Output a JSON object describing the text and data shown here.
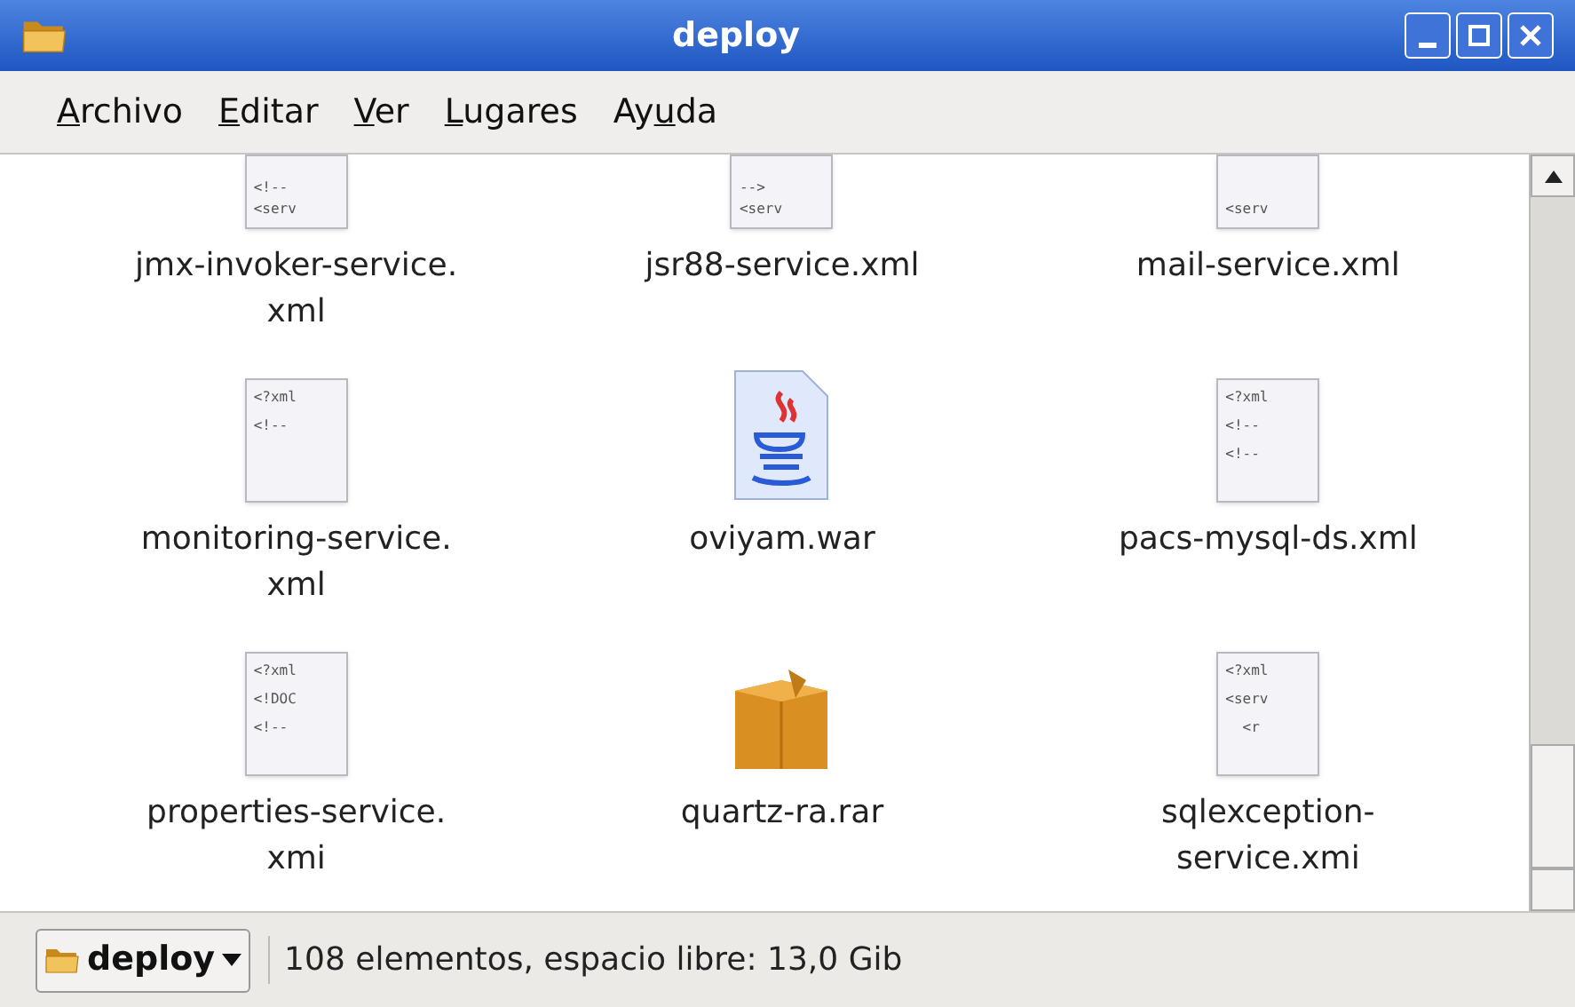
{
  "window": {
    "title": "deploy"
  },
  "menu": [
    {
      "label": "Archivo"
    },
    {
      "label": "Editar"
    },
    {
      "label": "Ver"
    },
    {
      "label": "Lugares"
    },
    {
      "label": "Ayuda"
    }
  ],
  "files": [
    {
      "kind": "xml",
      "label_lines": [
        "jmx-invoker-service.",
        "xml"
      ],
      "preview": [
        "<!--",
        "<serv"
      ]
    },
    {
      "kind": "xml",
      "label_lines": [
        "jsr88-service.xml"
      ],
      "preview": [
        "-->",
        "<serv"
      ]
    },
    {
      "kind": "xml",
      "label_lines": [
        "mail-service.xml"
      ],
      "preview": [
        "<serv"
      ]
    },
    {
      "kind": "xml",
      "label_lines": [
        "monitoring-service.",
        "xml"
      ],
      "preview": [
        "<?xml",
        "<!--"
      ]
    },
    {
      "kind": "java",
      "label_lines": [
        "oviyam.war"
      ]
    },
    {
      "kind": "xml",
      "label_lines": [
        "pacs-mysql-ds.xml"
      ],
      "preview": [
        "<?xml",
        "<!--",
        "<!--"
      ]
    },
    {
      "kind": "xml",
      "label_lines": [
        "properties-service.",
        "xmi"
      ],
      "preview": [
        "<?xml",
        "<!DOC",
        "<!--"
      ]
    },
    {
      "kind": "archive",
      "label_lines": [
        "quartz-ra.rar"
      ]
    },
    {
      "kind": "xml",
      "label_lines": [
        "sqlexception-",
        "service.xmi"
      ],
      "preview": [
        "<?xml",
        "<serv",
        "  <r"
      ]
    }
  ],
  "status_bar": {
    "location": "deploy",
    "text": "108 elementos, espacio libre: 13,0 Gib"
  }
}
